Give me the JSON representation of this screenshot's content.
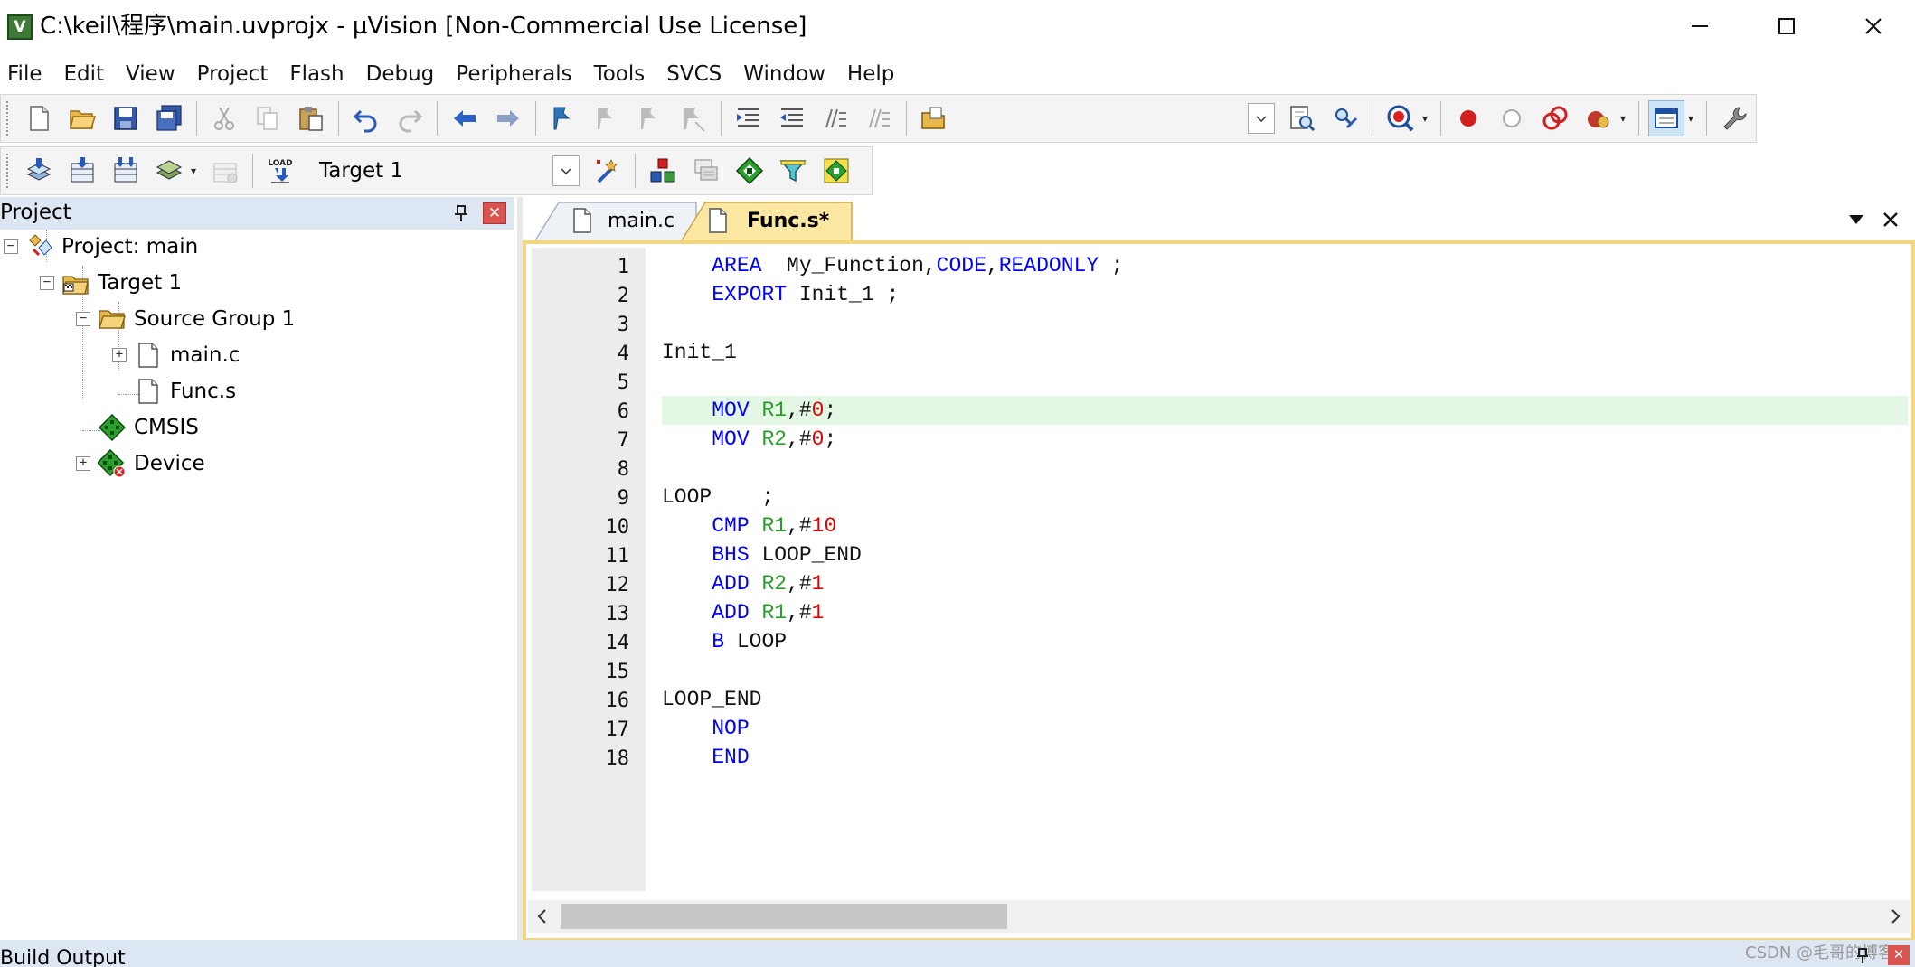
{
  "window": {
    "title": "C:\\keil\\程序\\main.uvprojx - µVision  [Non-Commercial Use License]",
    "controls": [
      "minimize",
      "maximize",
      "close"
    ]
  },
  "menu": {
    "items": [
      "File",
      "Edit",
      "View",
      "Project",
      "Flash",
      "Debug",
      "Peripherals",
      "Tools",
      "SVCS",
      "Window",
      "Help"
    ]
  },
  "toolbar1": {
    "icons": [
      "new-file-icon",
      "open-folder-icon",
      "save-icon",
      "save-all-icon",
      "cut-icon",
      "copy-icon",
      "paste-icon",
      "undo-icon",
      "redo-icon",
      "nav-back-icon",
      "nav-forward-icon",
      "bookmark-icon",
      "bookmark-prev-icon",
      "bookmark-next-icon",
      "bookmark-clear-icon",
      "indent-icon",
      "unindent-icon",
      "comment-icon",
      "uncomment-icon",
      "open-config-icon",
      "find-combo-icon",
      "find-in-files-icon",
      "incremental-find-icon",
      "debug-session-icon",
      "breakpoint-insert-icon",
      "breakpoint-enable-icon",
      "breakpoints-disable-icon",
      "breakpoints-kill-icon",
      "window-layout-icon",
      "configure-icon"
    ]
  },
  "toolbar2": {
    "target": "Target 1",
    "load_label": "LOAD",
    "icons": [
      "translate-icon",
      "build-icon",
      "rebuild-icon",
      "batch-build-icon",
      "stop-build-icon",
      "download-icon",
      "target-options-icon",
      "manage-components-icon",
      "pack-installer-icon",
      "run-time-env-icon",
      "select-packs-icon"
    ]
  },
  "project_panel": {
    "title": "Project",
    "tree": [
      {
        "label": "Project: main",
        "expander": "minus"
      },
      {
        "label": "Target 1",
        "expander": "minus"
      },
      {
        "label": "Source Group 1",
        "expander": "minus"
      },
      {
        "label": "main.c",
        "expander": "plus"
      },
      {
        "label": "Func.s",
        "expander": ""
      },
      {
        "label": "CMSIS",
        "expander": ""
      },
      {
        "label": "Device",
        "expander": "plus"
      }
    ]
  },
  "editor": {
    "tabs": [
      {
        "label": "main.c",
        "active": false
      },
      {
        "label": "Func.s*",
        "active": true
      }
    ],
    "highlighted_line": 6,
    "lines": [
      {
        "n": "1",
        "indent": "    ",
        "tokens": [
          [
            "kw",
            "AREA"
          ],
          [
            "t",
            "  My_Function,"
          ],
          [
            "kw",
            "CODE"
          ],
          [
            "t",
            ","
          ],
          [
            "kw",
            "READONLY"
          ],
          [
            "t",
            " ;"
          ]
        ]
      },
      {
        "n": "2",
        "indent": "    ",
        "tokens": [
          [
            "kw",
            "EXPORT"
          ],
          [
            "t",
            " Init_1 ;"
          ]
        ]
      },
      {
        "n": "3",
        "indent": "",
        "tokens": []
      },
      {
        "n": "4",
        "indent": "",
        "tokens": [
          [
            "t",
            "Init_1"
          ]
        ]
      },
      {
        "n": "5",
        "indent": "",
        "tokens": []
      },
      {
        "n": "6",
        "indent": "    ",
        "tokens": [
          [
            "kw",
            "MOV"
          ],
          [
            "t",
            " "
          ],
          [
            "reg",
            "R1"
          ],
          [
            "t",
            ",#"
          ],
          [
            "num",
            "0"
          ],
          [
            "t",
            ";"
          ]
        ]
      },
      {
        "n": "7",
        "indent": "    ",
        "tokens": [
          [
            "kw",
            "MOV"
          ],
          [
            "t",
            " "
          ],
          [
            "reg",
            "R2"
          ],
          [
            "t",
            ",#"
          ],
          [
            "num",
            "0"
          ],
          [
            "t",
            ";"
          ]
        ]
      },
      {
        "n": "8",
        "indent": "",
        "tokens": []
      },
      {
        "n": "9",
        "indent": "",
        "tokens": [
          [
            "t",
            "LOOP    ;"
          ]
        ]
      },
      {
        "n": "10",
        "indent": "    ",
        "tokens": [
          [
            "kw",
            "CMP"
          ],
          [
            "t",
            " "
          ],
          [
            "reg",
            "R1"
          ],
          [
            "t",
            ",#"
          ],
          [
            "num",
            "10"
          ]
        ]
      },
      {
        "n": "11",
        "indent": "    ",
        "tokens": [
          [
            "kw",
            "BHS"
          ],
          [
            "t",
            " LOOP_END"
          ]
        ]
      },
      {
        "n": "12",
        "indent": "    ",
        "tokens": [
          [
            "kw",
            "ADD"
          ],
          [
            "t",
            " "
          ],
          [
            "reg",
            "R2"
          ],
          [
            "t",
            ",#"
          ],
          [
            "num",
            "1"
          ]
        ]
      },
      {
        "n": "13",
        "indent": "    ",
        "tokens": [
          [
            "kw",
            "ADD"
          ],
          [
            "t",
            " "
          ],
          [
            "reg",
            "R1"
          ],
          [
            "t",
            ",#"
          ],
          [
            "num",
            "1"
          ]
        ]
      },
      {
        "n": "14",
        "indent": "    ",
        "tokens": [
          [
            "kw",
            "B"
          ],
          [
            "t",
            " LOOP"
          ]
        ]
      },
      {
        "n": "15",
        "indent": "",
        "tokens": []
      },
      {
        "n": "16",
        "indent": "",
        "tokens": [
          [
            "t",
            "LOOP_END"
          ]
        ]
      },
      {
        "n": "17",
        "indent": "    ",
        "tokens": [
          [
            "kw",
            "NOP"
          ]
        ]
      },
      {
        "n": "18",
        "indent": "    ",
        "tokens": [
          [
            "kw",
            "END"
          ]
        ]
      }
    ],
    "horizontal_scroll_fraction": 0.0
  },
  "build_output": {
    "title": "Build Output"
  },
  "watermark": "CSDN @毛哥的博客",
  "colors": {
    "keyword": "#0000ff",
    "register": "#2a9a2a",
    "number": "#e00000",
    "current_line": "#e4f7e4",
    "editor_frame": "#f2d681",
    "active_tab": "#fbe7a1",
    "panel_header": "#dde7f3"
  }
}
